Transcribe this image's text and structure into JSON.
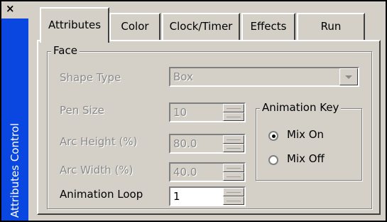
{
  "window": {
    "close_glyph": "×",
    "vertical_title": "Attributes Control"
  },
  "tabs": [
    {
      "label": "Attributes",
      "active": true
    },
    {
      "label": "Color",
      "active": false
    },
    {
      "label": "Clock/Timer",
      "active": false
    },
    {
      "label": "Effects",
      "active": false
    },
    {
      "label": "Run",
      "active": false
    }
  ],
  "face": {
    "group_label": "Face",
    "shape_type": {
      "label": "Shape Type",
      "value": "Box",
      "enabled": false
    },
    "pen_size": {
      "label": "Pen Size",
      "value": "10",
      "enabled": false
    },
    "arc_height": {
      "label": "Arc Height (%)",
      "value": "80.0",
      "enabled": false
    },
    "arc_width": {
      "label": "Arc Width (%)",
      "value": "40.0",
      "enabled": false
    },
    "animation_loop": {
      "label": "Animation Loop",
      "value": "1",
      "enabled": true
    },
    "animation_key": {
      "group_label": "Animation Key",
      "options": [
        {
          "label": "Mix On",
          "selected": true
        },
        {
          "label": "Mix Off",
          "selected": false
        }
      ]
    }
  },
  "colors": {
    "title_bar": "#0a46e0",
    "face": "#d4d0c8",
    "disabled_text": "#8a8a8a"
  }
}
